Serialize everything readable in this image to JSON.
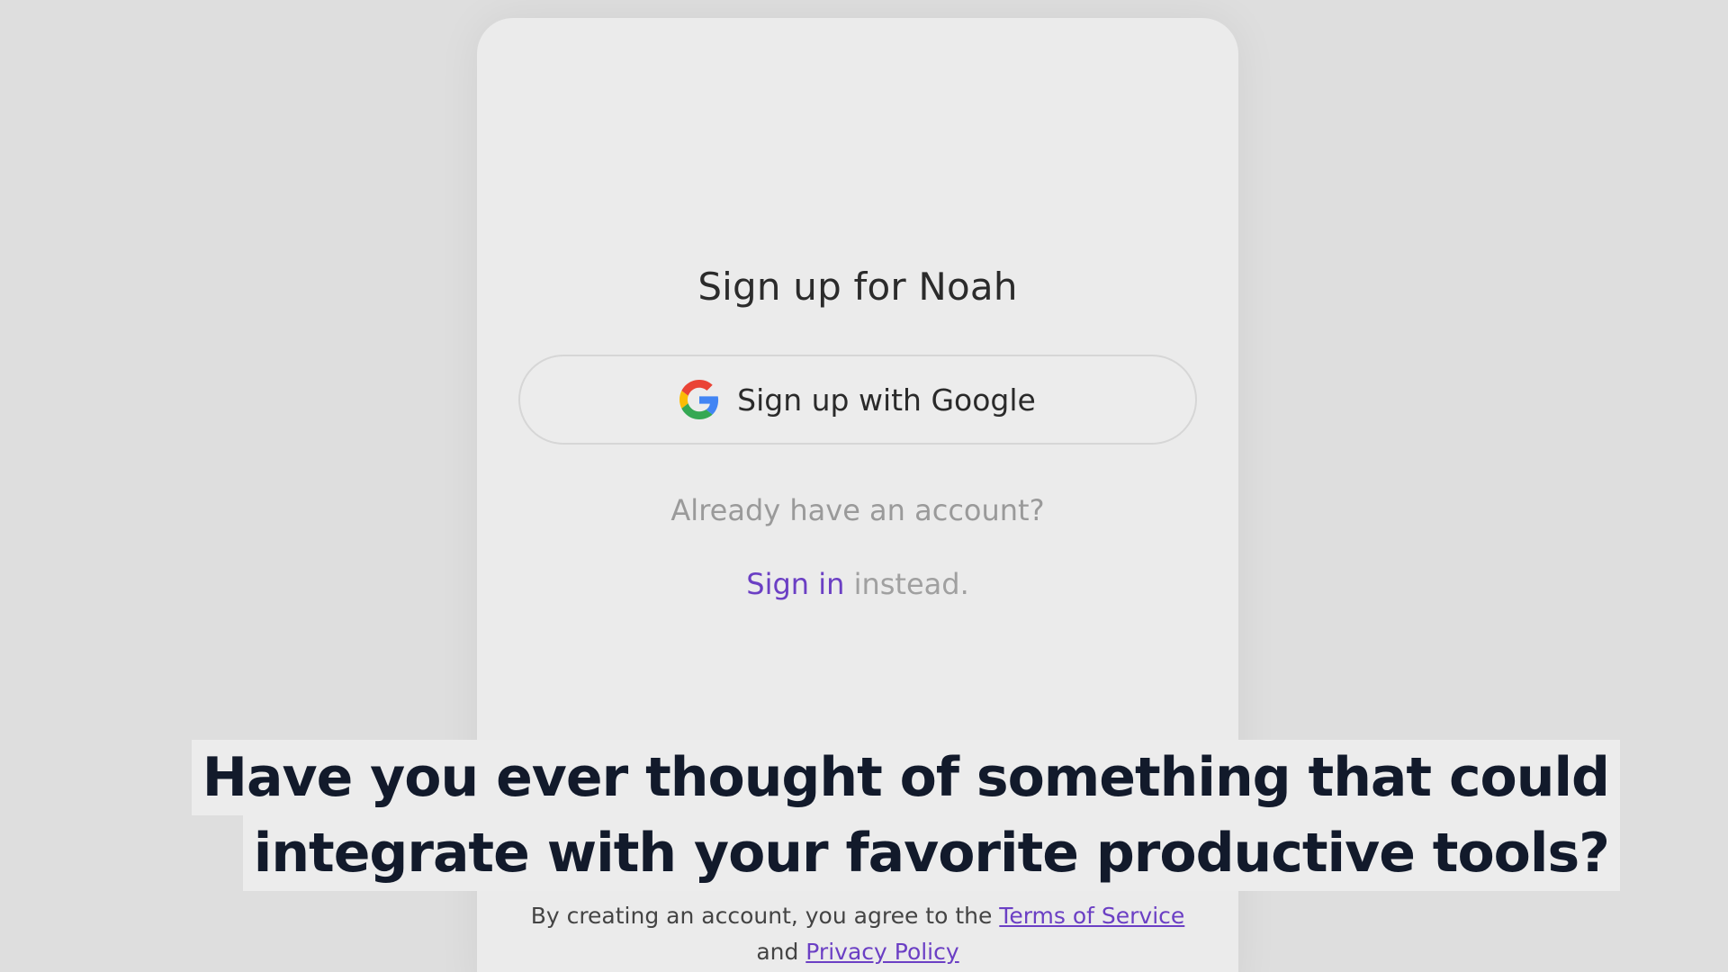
{
  "signup": {
    "title": "Sign up for Noah",
    "google_button_label": "Sign up with Google",
    "already_text": "Already have an account?",
    "signin_link": "Sign in",
    "signin_suffix": " instead."
  },
  "terms": {
    "prefix": "By creating an account, you agree to the ",
    "terms_link": "Terms of Service",
    "conjunction": " and ",
    "privacy_link": "Privacy Policy"
  },
  "caption": {
    "line1": "Have you ever thought of something that could",
    "line2": "integrate with your favorite productive tools?"
  },
  "colors": {
    "accent": "#6b3fc4",
    "background": "#dedede",
    "card": "#ebebeb",
    "caption_text": "#121a2b"
  },
  "icons": {
    "google": "google-g-icon"
  }
}
